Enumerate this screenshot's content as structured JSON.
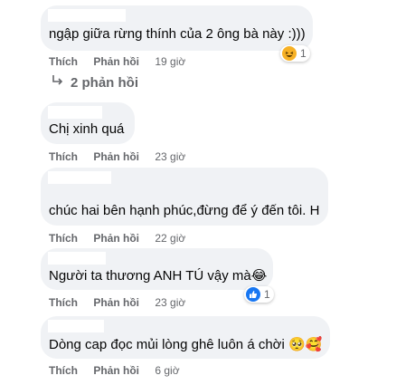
{
  "comments": [
    {
      "text": "ngập giữa rừng thính của 2 ông bà này :)))",
      "like": "Thích",
      "reply": "Phản hồi",
      "time": "19 giờ",
      "reaction_count": "1",
      "reaction": "haha-icon"
    },
    {
      "text": "Chị xinh quá",
      "like": "Thích",
      "reply": "Phản hồi",
      "time": "23 giờ"
    },
    {
      "text": "chúc hai bên hạnh phúc,đừng để ý đến tôi. H",
      "like": "Thích",
      "reply": "Phản hồi",
      "time": "22 giờ"
    },
    {
      "text": "Người ta thương ANH TÚ vậy mà😂",
      "like": "Thích",
      "reply": "Phản hồi",
      "time": "23 giờ",
      "reaction_count": "1",
      "reaction": "like-icon"
    },
    {
      "text": "Dòng cap đọc mủi lòng ghê luôn á chời 🥺🥰",
      "like": "Thích",
      "reply": "Phản hồi",
      "time": "6 giờ"
    }
  ],
  "replies_link": "2 phản hồi",
  "colors": {
    "bubble": "#f0f2f5",
    "meta": "#65676b",
    "like_blue": "#1877f2",
    "haha_yellow": "#f7b125"
  }
}
